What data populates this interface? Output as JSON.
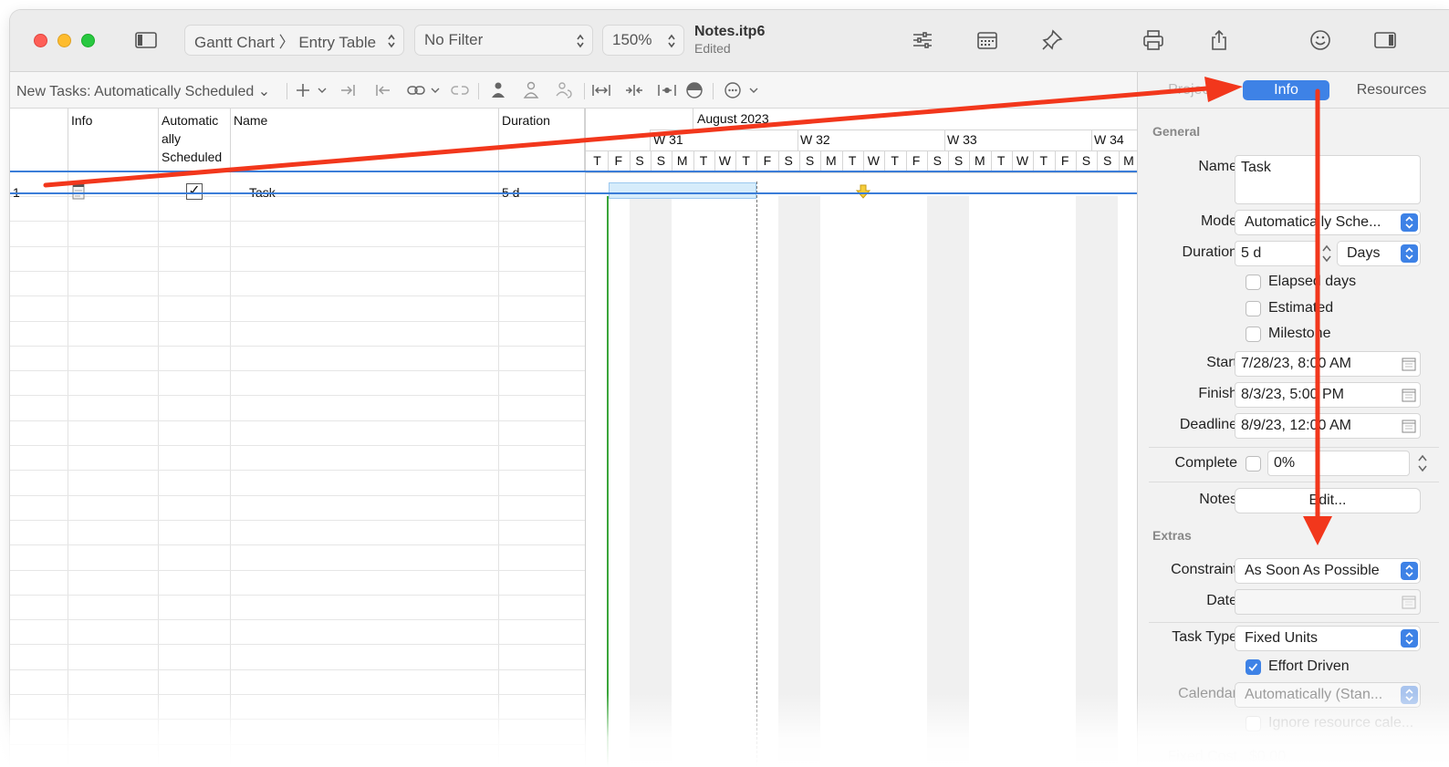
{
  "window": {
    "view_popup": "Gantt Chart 〉 Entry Table",
    "filter_popup": "No Filter",
    "zoom_popup": "150%",
    "doc_name": "Notes.itp6",
    "doc_status": "Edited"
  },
  "toolbar2": {
    "new_tasks_label": "New Tasks: Automatically Scheduled"
  },
  "table": {
    "columns": [
      "Info",
      "Automatic ally Scheduled",
      "Name",
      "Duration"
    ],
    "rows": [
      {
        "id": "1",
        "name": "Task",
        "duration": "5 d",
        "auto": "✓"
      }
    ]
  },
  "gantt": {
    "month": "August 2023",
    "weeks": [
      "W 31",
      "W 32",
      "W 33",
      "W 34"
    ],
    "days": [
      "T",
      "F",
      "S",
      "S",
      "M",
      "T",
      "W",
      "T",
      "F",
      "S",
      "S",
      "M",
      "T",
      "W",
      "T",
      "F",
      "S",
      "S",
      "M",
      "T",
      "W",
      "T",
      "F",
      "S",
      "S",
      "M"
    ]
  },
  "inspector": {
    "tabs": [
      "Project",
      "Info",
      "Resources"
    ],
    "section_general": "General",
    "name_label": "Name",
    "name_value": "Task",
    "mode_label": "Mode",
    "mode_value": "Automatically Sche...",
    "duration_label": "Duration",
    "duration_value": "5 d",
    "duration_unit": "Days",
    "elapsed_days": "Elapsed days",
    "estimated": "Estimated",
    "milestone": "Milestone",
    "start_label": "Start",
    "start_value": "7/28/23, 8:00 AM",
    "finish_label": "Finish",
    "finish_value": "8/3/23, 5:00 PM",
    "deadline_label": "Deadline",
    "deadline_value": "8/9/23, 12:00 AM",
    "complete_label": "Complete",
    "complete_value": "0%",
    "notes_label": "Notes",
    "notes_button": "Edit...",
    "section_extras": "Extras",
    "constraint_label": "Constraint",
    "constraint_value": "As Soon As Possible",
    "date_label": "Date",
    "task_type_label": "Task Type",
    "task_type_value": "Fixed Units",
    "effort_driven": "Effort Driven",
    "calendar_label": "Calendar",
    "calendar_value": "Automatically (Stan...",
    "ignore_resource": "Ignore resource cale...",
    "fixed_cost_label": "Fixed Cost",
    "fixed_cost_value": "$0.00"
  },
  "colors": {
    "accent": "#3e82e6",
    "annotation_arrow": "#f2371c",
    "selection": "#3b7dd8",
    "task_bar": "#d6ecfb"
  }
}
